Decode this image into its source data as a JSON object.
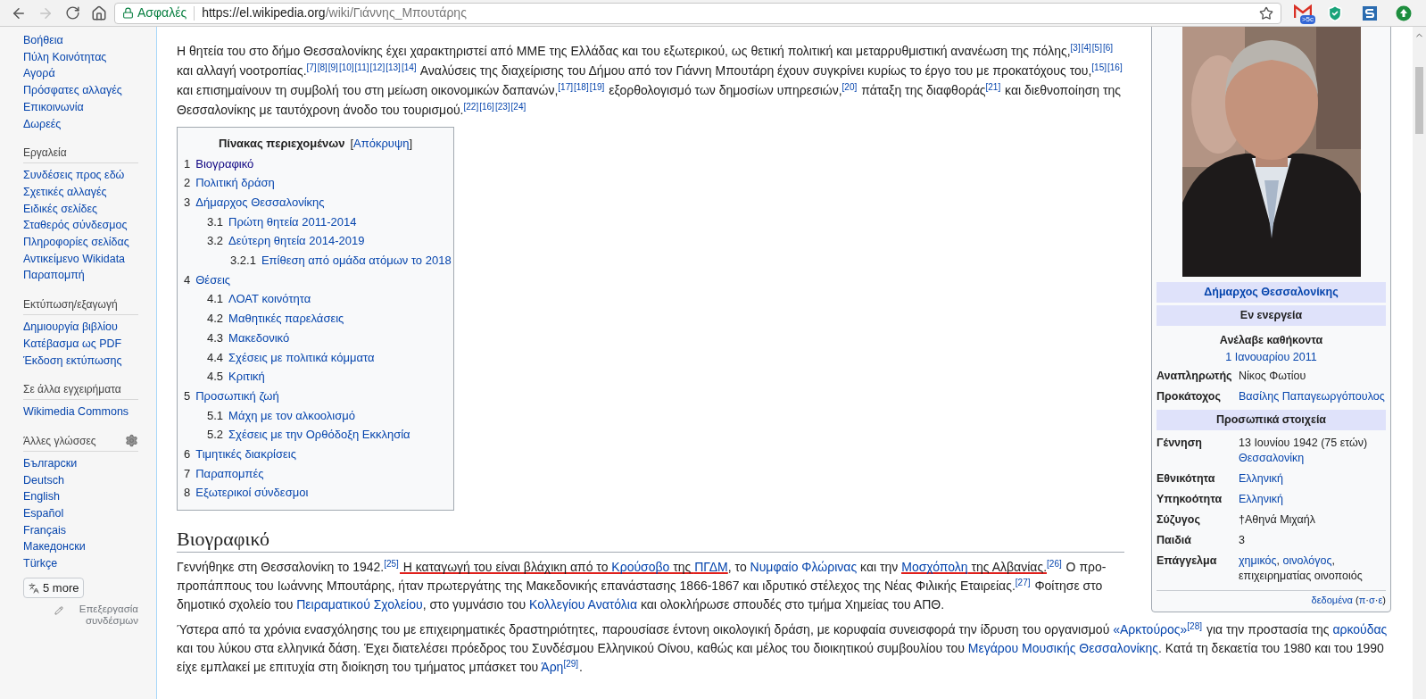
{
  "browser": {
    "back_disabled": false,
    "forward_disabled": true,
    "secure_label": "Ασφαλές",
    "url_domain": "https://el.wikipedia.org",
    "url_path": "/wiki/Γιάννης_Μπουτάρης",
    "bookmarked": false,
    "mail_badge": ">5c"
  },
  "sidebar": {
    "sections": [
      {
        "settings": false,
        "items": [
          "Βοήθεια",
          "Πύλη Κοινότητας",
          "Αγορά",
          "Πρόσφατες αλλαγές",
          "Επικοινωνία",
          "Δωρεές"
        ]
      },
      {
        "title": "Εργαλεία",
        "settings": false,
        "items": [
          "Συνδέσεις προς εδώ",
          "Σχετικές αλλαγές",
          "Ειδικές σελίδες",
          "Σταθερός σύνδεσμος",
          "Πληροφορίες σελίδας",
          "Αντικείμενο Wikidata",
          "Παραπομπή"
        ]
      },
      {
        "title": "Εκτύπωση/εξαγωγή",
        "settings": false,
        "items": [
          "Δημιουργία βιβλίου",
          "Κατέβασμα ως PDF",
          "Έκδοση εκτύπωσης"
        ]
      },
      {
        "title": "Σε άλλα εγχειρήματα",
        "settings": false,
        "items": [
          "Wikimedia Commons"
        ]
      },
      {
        "title": "Άλλες γλώσσες",
        "settings": true,
        "items": [
          "Български",
          "Deutsch",
          "English",
          "Español",
          "Français",
          "Македонски",
          "Türkçe"
        ]
      }
    ],
    "more_button": "5 more",
    "edit_links": "Επεξεργασία συνδέσμων"
  },
  "intro": [
    {
      "kind": "text",
      "text": "Η θητεία του στο δήμο Θεσσαλονίκης έχει χαρακτηριστεί από ΜΜΕ της Ελλάδας και του εξωτερικού, ως θετική πολιτική και μεταρρυθμιστική ανανέωση της πόλης,"
    },
    {
      "kind": "refs",
      "items": [
        "[3]",
        "[4]",
        "[5]",
        "[6]"
      ]
    },
    {
      "kind": "text",
      "text": " και αλλαγή νοοτροπίας."
    },
    {
      "kind": "refs",
      "items": [
        "[7]",
        "[8]",
        "[9]",
        "[10]",
        "[11]",
        "[12]",
        "[13]",
        "[14]"
      ]
    },
    {
      "kind": "text",
      "text": " Αναλύσεις της διαχείρισης του Δήμου από τον Γιάννη Μπουτάρη έχουν συγκρίνει κυρίως το έργο του με προκατόχους του,"
    },
    {
      "kind": "refs",
      "items": [
        "[15]",
        "[16]"
      ]
    },
    {
      "kind": "text",
      "text": " και επισημαίνουν τη συμβολή του στη μείωση οικονομικών δαπανών,"
    },
    {
      "kind": "refs",
      "items": [
        "[17]",
        "[18]",
        "[19]"
      ]
    },
    {
      "kind": "text",
      "text": " εξορθολογισμό των δημοσίων υπηρεσιών,"
    },
    {
      "kind": "refs",
      "items": [
        "[20]"
      ]
    },
    {
      "kind": "text",
      "text": " πάταξη της διαφθοράς"
    },
    {
      "kind": "refs",
      "items": [
        "[21]"
      ]
    },
    {
      "kind": "text",
      "text": " και διεθνοποίηση της Θεσσαλονίκης με ταυτόχρονη άνοδο του τουρισμού."
    },
    {
      "kind": "refs",
      "items": [
        "[22]",
        "[16]",
        "[23]",
        "[24]"
      ]
    }
  ],
  "toc": {
    "title": "Πίνακας περιεχομένων",
    "toggle_open": "[",
    "toggle": "Απόκρυψη",
    "toggle_close": "]",
    "items": [
      {
        "number": "1",
        "label": "Βιογραφικό",
        "visited": true
      },
      {
        "number": "2",
        "label": "Πολιτική δράση",
        "visited": false
      },
      {
        "number": "3",
        "label": "Δήμαρχος Θεσσαλονίκης",
        "visited": false,
        "children": [
          {
            "number": "3.1",
            "label": "Πρώτη θητεία 2011-2014",
            "visited": false
          },
          {
            "number": "3.2",
            "label": "Δεύτερη θητεία 2014-2019",
            "visited": false,
            "children": [
              {
                "number": "3.2.1",
                "label": "Επίθεση από ομάδα ατόμων το 2018",
                "visited": false
              }
            ]
          }
        ]
      },
      {
        "number": "4",
        "label": "Θέσεις",
        "visited": false,
        "children": [
          {
            "number": "4.1",
            "label": "ΛΟΑΤ κοινότητα",
            "visited": false
          },
          {
            "number": "4.2",
            "label": "Μαθητικές παρελάσεις",
            "visited": false
          },
          {
            "number": "4.3",
            "label": "Μακεδονικό",
            "visited": false
          },
          {
            "number": "4.4",
            "label": "Σχέσεις με πολιτικά κόμματα",
            "visited": false
          },
          {
            "number": "4.5",
            "label": "Κριτική",
            "visited": false
          }
        ]
      },
      {
        "number": "5",
        "label": "Προσωπική ζωή",
        "visited": false,
        "children": [
          {
            "number": "5.1",
            "label": "Μάχη με τον αλκοολισμό",
            "visited": false
          },
          {
            "number": "5.2",
            "label": "Σχέσεις με την Ορθόδοξη Εκκλησία",
            "visited": false
          }
        ]
      },
      {
        "number": "6",
        "label": "Τιμητικές διακρίσεις",
        "visited": false
      },
      {
        "number": "7",
        "label": "Παραπομπές",
        "visited": false
      },
      {
        "number": "8",
        "label": "Εξωτερικοί σύνδεσμοι",
        "visited": false
      }
    ]
  },
  "section": {
    "heading": "Βιογραφικό",
    "paragraphs": [
      [
        {
          "kind": "text",
          "text": "Γεννήθηκε στη Θεσσαλονίκη το 1942.",
          "marked": false
        },
        {
          "kind": "refs",
          "items": [
            "[25]"
          ]
        },
        {
          "kind": "text",
          "text": " Η καταγωγή του είναι βλάχικη από το ",
          "marked": true
        },
        {
          "kind": "link",
          "text": "Κρούσοβο",
          "marked": true
        },
        {
          "kind": "text",
          "text": " της ",
          "marked": true
        },
        {
          "kind": "link",
          "text": "ΠΓΔΜ",
          "marked": true
        },
        {
          "kind": "text",
          "text": ", το ",
          "marked": false
        },
        {
          "kind": "link",
          "text": "Νυμφαίο Φλώρινας",
          "marked": false
        },
        {
          "kind": "text",
          "text": " και την ",
          "marked": false
        },
        {
          "kind": "link",
          "text": "Μοσχόπολη",
          "marked": true
        },
        {
          "kind": "text",
          "text": " της Αλβανίας.",
          "marked": true
        },
        {
          "kind": "refs",
          "items": [
            "[26]"
          ]
        },
        {
          "kind": "text",
          "text": " Ο προ-προπάππους του Ιωάννης Μπουτάρης, ήταν πρωτεργάτης της Μακεδονικής επανάστασης 1866-1867 και ιδρυτικό στέλεχος της Νέας Φιλικής Εταιρείας.",
          "marked": false
        },
        {
          "kind": "refs",
          "items": [
            "[27]"
          ]
        },
        {
          "kind": "text",
          "text": " Φοίτησε στο δημοτικό σχολείο του ",
          "marked": false
        },
        {
          "kind": "link",
          "text": "Πειραματικού Σχολείου",
          "marked": false
        },
        {
          "kind": "text",
          "text": ", στο γυμνάσιο του ",
          "marked": false
        },
        {
          "kind": "link",
          "text": "Κολλεγίου Ανατόλια",
          "marked": false
        },
        {
          "kind": "text",
          "text": " και ολοκλήρωσε σπουδές στο τμήμα Χημείας του ΑΠΘ.",
          "marked": false
        }
      ],
      [
        {
          "kind": "text",
          "text": "Ύστερα από τα χρόνια ενασχόλησης του με επιχειρηματικές δραστηριότητες, παρουσίασε έντονη οικολογική δράση, με κορυφαία συνεισφορά την ίδρυση του οργανισμού "
        },
        {
          "kind": "link",
          "text": "«Αρκτούρος»"
        },
        {
          "kind": "refs",
          "items": [
            "[28]"
          ]
        },
        {
          "kind": "text",
          "text": " για την προστασία της "
        },
        {
          "kind": "link",
          "text": "αρκούδας"
        },
        {
          "kind": "text",
          "text": " και του λύκου στα ελληνικά δάση. Έχει διατελέσει πρόεδρος του Συνδέσμου Ελληνικού Οίνου, καθώς και μέλος του διοικητικού συμβουλίου του "
        },
        {
          "kind": "link",
          "text": "Μεγάρου Μουσικής Θεσσαλονίκης"
        },
        {
          "kind": "text",
          "text": ". Κατά τη δεκαετία του 1980 και του 1990 είχε εμπλακεί με επιτυχία στη διοίκηση του τμήματος μπάσκετ του "
        },
        {
          "kind": "link",
          "text": "Άρη"
        },
        {
          "kind": "refs",
          "items": [
            "[29]"
          ]
        },
        {
          "kind": "text",
          "text": "."
        }
      ]
    ]
  },
  "infobox": {
    "rows": [
      {
        "kind": "header",
        "text": "Δήμαρχος Θεσσαλονίκης",
        "link": true
      },
      {
        "kind": "header",
        "text": "Εν ενεργεία",
        "link": false
      },
      {
        "kind": "subheading",
        "text": "Ανέλαβε καθήκοντα"
      },
      {
        "kind": "center",
        "value": [
          {
            "kind": "link",
            "text": "1 Ιανουαρίου 2011"
          }
        ]
      },
      {
        "kind": "field",
        "label": "Αναπληρωτής",
        "value": [
          {
            "kind": "text",
            "text": "Νίκος Φωτίου"
          }
        ]
      },
      {
        "kind": "field",
        "label": "Προκάτοχος",
        "value": [
          {
            "kind": "link",
            "text": "Βασίλης Παπαγεωργόπουλος"
          }
        ]
      },
      {
        "kind": "header",
        "text": "Προσωπικά στοιχεία",
        "link": false
      },
      {
        "kind": "field",
        "label": "Γέννηση",
        "value": [
          {
            "kind": "text",
            "text": "13 Ιουνίου 1942 (75 ετών) "
          },
          {
            "kind": "link",
            "text": "Θεσσαλονίκη"
          }
        ]
      },
      {
        "kind": "field",
        "label": "Εθνικότητα",
        "value": [
          {
            "kind": "link",
            "text": "Ελληνική"
          }
        ]
      },
      {
        "kind": "field",
        "label": "Υπηκοότητα",
        "value": [
          {
            "kind": "link",
            "text": "Ελληνική"
          }
        ]
      },
      {
        "kind": "field",
        "label": "Σύζυγος",
        "value": [
          {
            "kind": "text",
            "text": "†Αθηνά Μιχαήλ"
          }
        ]
      },
      {
        "kind": "field",
        "label": "Παιδιά",
        "value": [
          {
            "kind": "text",
            "text": "3"
          }
        ]
      },
      {
        "kind": "field",
        "label": "Επάγγελμα",
        "value": [
          {
            "kind": "link",
            "text": "χημικός"
          },
          {
            "kind": "text",
            "text": ", "
          },
          {
            "kind": "link",
            "text": "οινολόγος"
          },
          {
            "kind": "text",
            "text": ", επιχειρηματίας οινοποιός"
          }
        ]
      }
    ],
    "footer": [
      {
        "kind": "link",
        "text": "δεδομένα"
      },
      {
        "kind": "text",
        "text": " ("
      },
      {
        "kind": "link",
        "text": "π"
      },
      {
        "kind": "text",
        "text": "·"
      },
      {
        "kind": "link",
        "text": "σ"
      },
      {
        "kind": "text",
        "text": "·"
      },
      {
        "kind": "link",
        "text": "ε"
      },
      {
        "kind": "text",
        "text": ")"
      }
    ]
  }
}
